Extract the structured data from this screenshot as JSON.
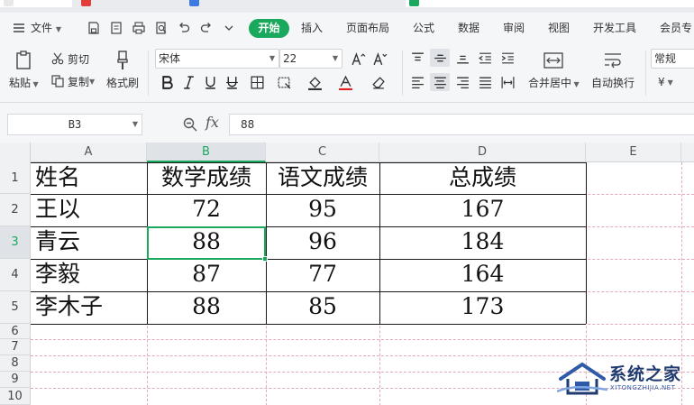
{
  "menubar": {
    "file_menu": "文件",
    "tabs": [
      "开始",
      "插入",
      "页面布局",
      "公式",
      "数据",
      "审阅",
      "视图",
      "开发工具",
      "会员专"
    ]
  },
  "ribbon": {
    "paste": "粘贴",
    "cut": "剪切",
    "copy": "复制",
    "format_painter": "格式刷",
    "font_name": "宋体",
    "font_size": "22",
    "merge_center": "合并居中",
    "wrap_text": "自动换行",
    "number_format": "常规",
    "currency_symbol": "¥"
  },
  "formula_bar": {
    "name_box": "B3",
    "fx": "fx",
    "content": "88"
  },
  "sheet": {
    "columns": [
      "A",
      "B",
      "C",
      "D",
      "E"
    ],
    "rows": [
      "1",
      "2",
      "3",
      "4",
      "5",
      "6",
      "7",
      "8",
      "9",
      "10"
    ],
    "header": [
      "姓名",
      "数学成绩",
      "语文成绩",
      "总成绩"
    ],
    "data": [
      [
        "王以",
        "72",
        "95",
        "167"
      ],
      [
        "青云",
        "88",
        "96",
        "184"
      ],
      [
        "李毅",
        "87",
        "77",
        "164"
      ],
      [
        "李木子",
        "88",
        "85",
        "173"
      ]
    ],
    "active_cell": "B3"
  },
  "watermark": {
    "title": "系统之家",
    "subtitle": "XITONGZHIJIA.NET"
  },
  "colors": {
    "accent": "#1aa85c",
    "watermark": "#1f3b70"
  }
}
